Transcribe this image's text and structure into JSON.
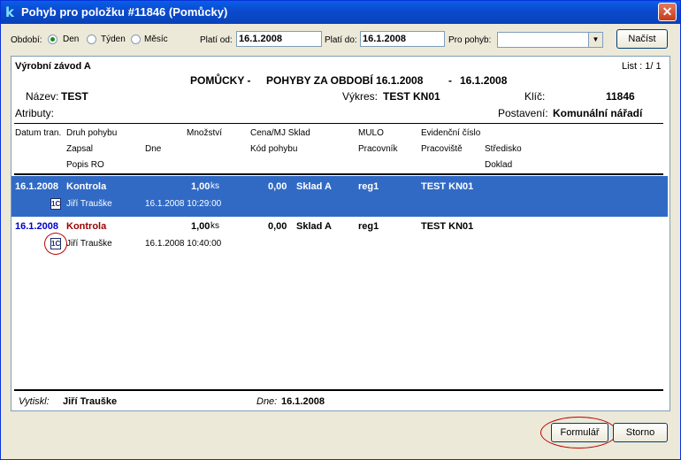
{
  "window": {
    "title": "Pohyb pro položku #11846 (Pomůcky)",
    "app_icon": "k"
  },
  "toolbar": {
    "period_label": "Období:",
    "period_options": [
      "Den",
      "Týden",
      "Měsíc"
    ],
    "from_label": "Platí od:",
    "from_value": "16.1.2008",
    "to_label": "Platí do:",
    "to_value": "16.1.2008",
    "movement_label": "Pro pohyb:",
    "movement_value": "",
    "load_button": "Načíst"
  },
  "report": {
    "company": "Výrobní závod A",
    "list": "List : 1/ 1",
    "heading_a": "POMŮCKY -",
    "heading_b": "POHYBY ZA OBDOBÍ 16.1.2008",
    "heading_c": "-",
    "heading_d": "16.1.2008",
    "name_label": "Název:",
    "name_value": "TEST",
    "drawing_label": "Výkres:",
    "drawing_value": "TEST KN01",
    "key_label": "Klíč:",
    "key_value": "11846",
    "attributes_label": "Atributy:",
    "status_label": "Postavení:",
    "status_value": "Komunální nářadí",
    "columns": {
      "date": "Datum tran.",
      "type": "Druh pohybu",
      "qty": "Množství",
      "price": "Cena/MJ Sklad",
      "mulo": "MULO",
      "evid": "Evidenční číslo",
      "recorded": "Zapsal",
      "day": "Dne",
      "code": "Kód pohybu",
      "worker": "Pracovník",
      "workplace": "Pracoviště",
      "center": "Středisko",
      "ro": "Popis RO",
      "doc": "Doklad"
    },
    "rows": [
      {
        "date": "16.1.2008",
        "type": "Kontrola",
        "qty": "1,00",
        "unit": "ks",
        "price": "0,00",
        "store": "Sklad A",
        "mulo": "reg1",
        "evid": "TEST KN01",
        "doc_icon": "document-icon",
        "recorded": "Jiří Trauške",
        "day": "16.1.2008 10:29:00"
      },
      {
        "date": "16.1.2008",
        "type": "Kontrola",
        "qty": "1,00",
        "unit": "ks",
        "price": "0,00",
        "store": "Sklad A",
        "mulo": "reg1",
        "evid": "TEST KN01",
        "doc_icon": "document-icon",
        "recorded": "Jiří Trauške",
        "day": "16.1.2008 10:40:00"
      }
    ],
    "footer": {
      "printed_label": "Vytiskl:",
      "printed_by": "Jiří Trauške",
      "date_label": "Dne:",
      "date_value": "16.1.2008"
    }
  },
  "buttons": {
    "form": "Formulář",
    "cancel": "Storno"
  },
  "colors": {
    "selection": "#316ac5",
    "date_blue": "#0000cc",
    "type_red": "#990000",
    "annotation": "#c00000"
  }
}
